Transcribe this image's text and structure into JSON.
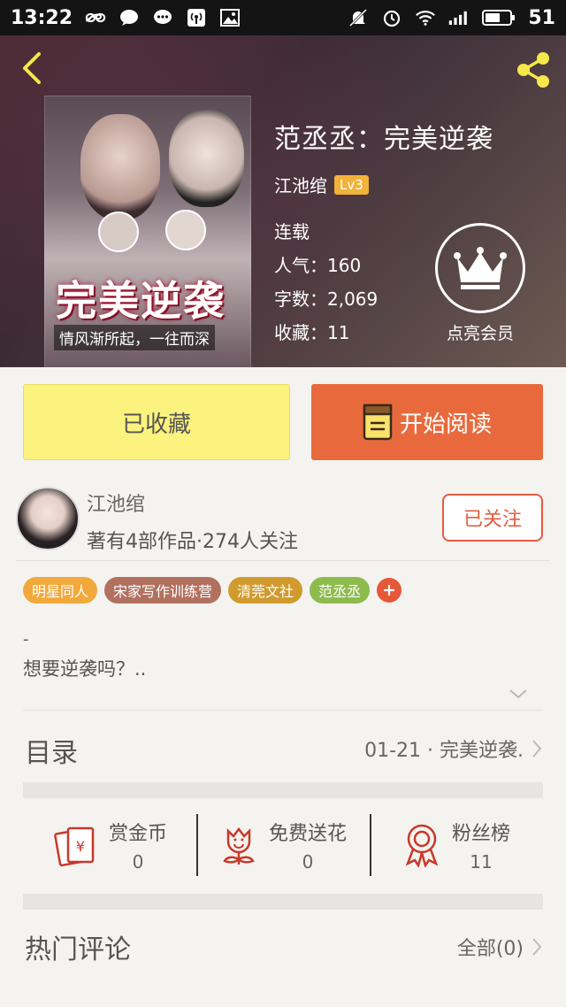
{
  "status_bar": {
    "time": "13:22",
    "battery": "51"
  },
  "book": {
    "title": "范丞丞：完美逆袭",
    "author": "江池绾",
    "level": "Lv3",
    "status": "连载",
    "popularity": "人气：160",
    "word_count": "字数：2,069",
    "favorites": "收藏：11",
    "cover_title": "完美逆袭",
    "cover_subtitle": "情风渐所起，一往而深"
  },
  "vip": {
    "label": "点亮会员"
  },
  "actions": {
    "favorited_label": "已收藏",
    "read_label": "开始阅读"
  },
  "author_card": {
    "name": "江池绾",
    "stats": "著有4部作品·274人关注",
    "follow_label": "已关注"
  },
  "tags": [
    {
      "label": "明星同人",
      "color": "#f2a93b"
    },
    {
      "label": "宋家写作训练营",
      "color": "#b2705e"
    },
    {
      "label": "清莞文社",
      "color": "#d09a2e"
    },
    {
      "label": "范丞丞",
      "color": "#8dbb4d"
    }
  ],
  "description": {
    "dash": "-",
    "text": "想要逆袭吗？.."
  },
  "toc": {
    "label": "目录",
    "latest": "01-21 · 完美逆袭."
  },
  "stats": [
    {
      "label": "赏金币",
      "value": "0",
      "icon": "red-envelope-icon"
    },
    {
      "label": "免费送花",
      "value": "0",
      "icon": "flower-icon"
    },
    {
      "label": "粉丝榜",
      "value": "11",
      "icon": "medal-icon"
    }
  ],
  "comments": {
    "label": "热门评论",
    "all": "全部(0)"
  },
  "colors": {
    "accent": "#e86a3c",
    "favorite_bg": "#fbf37d",
    "follow": "#e45c40"
  }
}
